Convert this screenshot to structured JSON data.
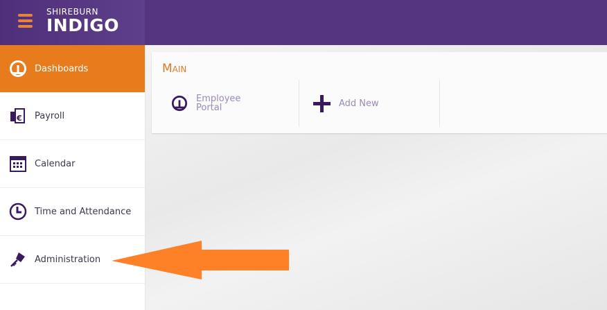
{
  "brand": {
    "line1": "SHIREBURN",
    "line2": "INDIGO"
  },
  "sidebar": {
    "items": [
      {
        "label": "Dashboards",
        "icon": "gauge-icon",
        "active": true
      },
      {
        "label": "Payroll",
        "icon": "payroll-euro-icon"
      },
      {
        "label": "Calendar",
        "icon": "calendar-icon"
      },
      {
        "label": "Time and Attendance",
        "icon": "clock-icon"
      },
      {
        "label": "Administration",
        "icon": "key-icon"
      }
    ]
  },
  "main": {
    "section_title": "Main",
    "tiles": [
      {
        "label_line1": "Employee",
        "label_line2": "Portal",
        "icon": "gauge-icon"
      },
      {
        "label": "Add New",
        "icon": "plus-icon"
      }
    ]
  },
  "colors": {
    "header": "#553580",
    "accent": "#e87b1c",
    "arrow": "#fe8127",
    "icon": "#3a1a5e"
  }
}
